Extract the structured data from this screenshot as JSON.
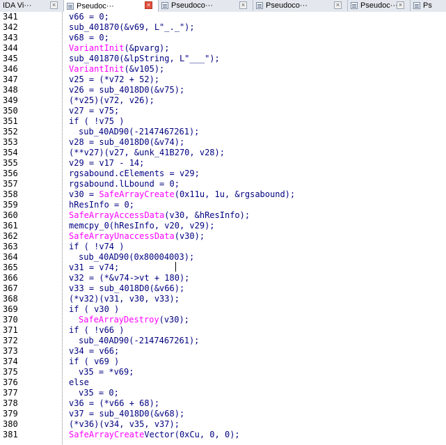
{
  "tabs": [
    {
      "label": "IDA Vi···",
      "active": false
    },
    {
      "label": "Pseudoc···",
      "active": true
    },
    {
      "label": "Pseudoco···",
      "active": false
    },
    {
      "label": "Pseudoco···",
      "active": false
    },
    {
      "label": "Pseudoc···",
      "active": false
    },
    {
      "label": "Ps",
      "active": false
    }
  ],
  "close_glyph": "×",
  "lines": [
    {
      "n": "341",
      "indent": 0,
      "text": "v66 = 0;"
    },
    {
      "n": "342",
      "indent": 0,
      "text": "sub_401870(&v69, L\"_._\");"
    },
    {
      "n": "343",
      "indent": 0,
      "text": "v68 = 0;"
    },
    {
      "n": "344",
      "indent": 0,
      "text": "VariantInit(&pvarg);"
    },
    {
      "n": "345",
      "indent": 0,
      "text": "sub_401870(&lpString, L\"___\");"
    },
    {
      "n": "346",
      "indent": 0,
      "text": "VariantInit(&v105);"
    },
    {
      "n": "347",
      "indent": 0,
      "text": "v25 = (*v72 + 52);"
    },
    {
      "n": "348",
      "indent": 0,
      "text": "v26 = sub_4018D0(&v75);"
    },
    {
      "n": "349",
      "indent": 0,
      "text": "(*v25)(v72, v26);"
    },
    {
      "n": "350",
      "indent": 0,
      "text": "v27 = v75;"
    },
    {
      "n": "351",
      "indent": 0,
      "text": "if ( !v75 )"
    },
    {
      "n": "352",
      "indent": 1,
      "text": "sub_40AD90(-2147467261);"
    },
    {
      "n": "353",
      "indent": 0,
      "text": "v28 = sub_4018D0(&v74);"
    },
    {
      "n": "354",
      "indent": 0,
      "text": "(**v27)(v27, &unk_41B270, v28);"
    },
    {
      "n": "355",
      "indent": 0,
      "text": "v29 = v17 - 14;"
    },
    {
      "n": "356",
      "indent": 0,
      "text": "rgsabound.cElements = v29;"
    },
    {
      "n": "357",
      "indent": 0,
      "text": "rgsabound.lLbound = 0;"
    },
    {
      "n": "358",
      "indent": 0,
      "text": "v30 = SafeArrayCreate(0x11u, 1u, &rgsabound);"
    },
    {
      "n": "359",
      "indent": 0,
      "text": "hResInfo = 0;"
    },
    {
      "n": "360",
      "indent": 0,
      "text": "SafeArrayAccessData(v30, &hResInfo);"
    },
    {
      "n": "361",
      "indent": 0,
      "text": "memcpy_0(hResInfo, v20, v29);"
    },
    {
      "n": "362",
      "indent": 0,
      "text": "SafeArrayUnaccessData(v30);"
    },
    {
      "n": "363",
      "indent": 0,
      "text": "if ( !v74 )"
    },
    {
      "n": "364",
      "indent": 1,
      "text": "sub_40AD90(0x80004003);"
    },
    {
      "n": "365",
      "indent": 0,
      "text": "v31 = v74;"
    },
    {
      "n": "366",
      "indent": 0,
      "text": "v32 = (*&v74->vt + 180);"
    },
    {
      "n": "367",
      "indent": 0,
      "text": "v33 = sub_4018D0(&v66);"
    },
    {
      "n": "368",
      "indent": 0,
      "text": "(*v32)(v31, v30, v33);"
    },
    {
      "n": "369",
      "indent": 0,
      "text": "if ( v30 )"
    },
    {
      "n": "370",
      "indent": 1,
      "text": "SafeArrayDestroy(v30);"
    },
    {
      "n": "371",
      "indent": 0,
      "text": "if ( !v66 )"
    },
    {
      "n": "372",
      "indent": 1,
      "text": "sub_40AD90(-2147467261);"
    },
    {
      "n": "373",
      "indent": 0,
      "text": "v34 = v66;"
    },
    {
      "n": "374",
      "indent": 0,
      "text": "if ( v69 )"
    },
    {
      "n": "375",
      "indent": 1,
      "text": "v35 = *v69;"
    },
    {
      "n": "376",
      "indent": 0,
      "text": "else"
    },
    {
      "n": "377",
      "indent": 1,
      "text": "v35 = 0;"
    },
    {
      "n": "378",
      "indent": 0,
      "text": "v36 = (*v66 + 68);"
    },
    {
      "n": "379",
      "indent": 0,
      "text": "v37 = sub_4018D0(&v68);"
    },
    {
      "n": "380",
      "indent": 0,
      "text": "(*v36)(v34, v35, v37);"
    },
    {
      "n": "381",
      "indent": 0,
      "text": "SafeArrayCreateVector(0xCu, 0, 0);"
    }
  ],
  "colors": {
    "code": "#000080",
    "api": "#ff00ff",
    "string": "#008000",
    "line_number": "#000000"
  }
}
